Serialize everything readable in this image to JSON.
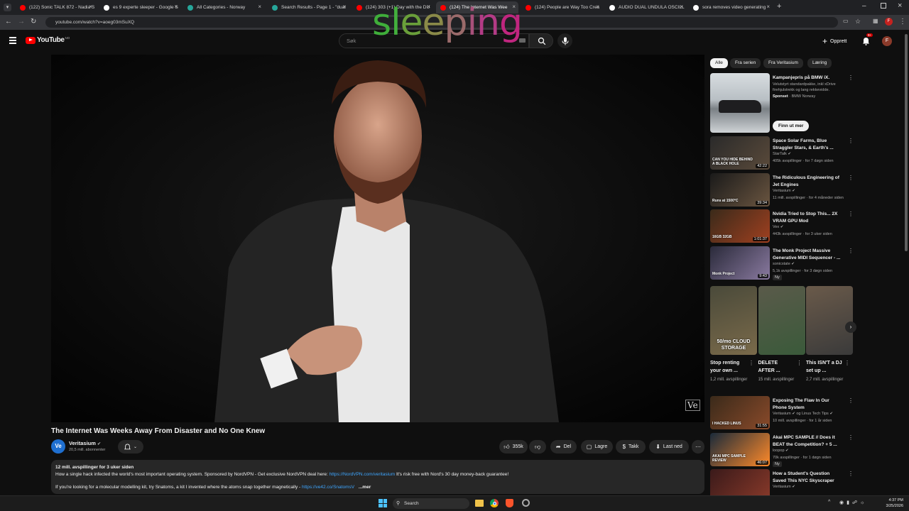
{
  "browser": {
    "tabs": [
      {
        "label": "(122) Sonic TALK 872 - Nadia S",
        "color": "#ff0000"
      },
      {
        "label": "es 9 experte sleeper - Google S",
        "color": "#ffffff"
      },
      {
        "label": "All Categories - Norway",
        "color": "#26a69a"
      },
      {
        "label": "Search Results - Page 1 - \"dual",
        "color": "#26a69a"
      },
      {
        "label": "(124) 303 (+1) Day with the DU",
        "color": "#ff0000"
      },
      {
        "label": "(124) The Internet Was Wee",
        "color": "#ff0000",
        "active": true
      },
      {
        "label": "(124) People are Way Too Crea",
        "color": "#ff0000"
      },
      {
        "label": "AUDIO DUAL UNDULA OSCILL",
        "color": "#ffffff"
      },
      {
        "label": "sora removes video generating",
        "color": "#ffffff"
      }
    ],
    "url": "youtube.com/watch?v=aoeg03mSuXQ"
  },
  "overlay_text": "sleeping",
  "youtube": {
    "logo_text": "YouTube",
    "region": "NO",
    "search_placeholder": "Søk",
    "create_label": "Opprett",
    "notif_count": "9+",
    "avatar_letter": "F"
  },
  "video": {
    "watermark": "Ve",
    "title": "The Internet Was Weeks Away From Disaster and No One Knew",
    "channel": "Veritasium",
    "channel_initials": "Ve",
    "subscribers": "20,5 mill. abonnenter",
    "likes": "355k",
    "share_label": "Del",
    "save_label": "Lagre",
    "thanks_label": "Takk",
    "download_label": "Last ned"
  },
  "description": {
    "stats": "12 mill. avspillinger  for 3 uker siden",
    "line1_a": "How a single hack infected the world's most important operating system. Sponsored by NordVPN - Get exclusive NordVPN deal here: ",
    "line1_link": "https://NordVPN.com/veritasium",
    "line1_b": " It's risk free with Nord's 30 day money-back guarantee!",
    "line2_a": "If you're looking for a molecular modelling kit, try Snatoms, a kit I invented where the atoms snap together magnetically - ",
    "line2_link": "https://ve42.co/SnatomsV",
    "more": "...mer"
  },
  "sidebar": {
    "chips": [
      "Alle",
      "Fra serien",
      "Fra Veritasium",
      "Læring"
    ],
    "ad": {
      "title": "Kampanjepris på BMW iX.",
      "body": "Velutstyrt standardpakke, inkl xDrive firehjulstrekk og lang rekkevidde.",
      "sponsor_label": "Sponset",
      "sponsor": "· BMW Norway",
      "cta": "Finn ut mer"
    },
    "videos": [
      {
        "title": "Space Solar Farms, Blue Straggler Stars, & Earth's ...",
        "channel": "StarTalk",
        "meta": "405k avspillinger · for 7 døgn siden",
        "duration": "42:22",
        "thumb_text": "CAN YOU HIDE BEHIND A BLACK HOLE",
        "c1": "#2a2a2a",
        "c2": "#5a4a3a"
      },
      {
        "title": "The Ridiculous Engineering of Jet Engines",
        "channel": "Veritasium",
        "meta": "11 mill. avspillinger · for 4 måneder siden",
        "duration": "39:34",
        "thumb_text": "Runs at 1500°C",
        "c1": "#1a1a1a",
        "c2": "#6a5540"
      },
      {
        "title": "Nvidia Tried to Stop This... 2X VRAM GPU Mod",
        "channel": "Vex",
        "meta": "443k avspillinger · for 3 uker siden",
        "duration": "1:01:37",
        "thumb_text": "16GB 32GB",
        "c1": "#3a2a1a",
        "c2": "#a04020"
      },
      {
        "title": "The Monk Project Massive Generative MIDI Sequencer - ...",
        "channel": "sonicstate",
        "meta": "5,1k avspillinger · for 3 døgn siden",
        "duration": "9:43",
        "thumb_text": "Monk Project",
        "badge": "Ny",
        "c1": "#2a2a3a",
        "c2": "#8a7aa0"
      }
    ],
    "shorts": [
      {
        "title": "Stop renting your own ...",
        "views": "1,2 mill. avspillinger",
        "caption": "50/mo CLOUD STORAGE",
        "c1": "#4a4a3a",
        "c2": "#7a6a4a"
      },
      {
        "title": "DELETE AFTER ...",
        "views": "15 mill. avspillinger",
        "caption": "",
        "c1": "#5a5a4a",
        "c2": "#3a5a3a"
      },
      {
        "title": "This ISN'T a DJ set up ...",
        "views": "2,7 mill. avspillinger",
        "caption": "",
        "c1": "#6a5a4a",
        "c2": "#3a3a3a"
      }
    ],
    "videos2": [
      {
        "title": "Exposing The Flaw In Our Phone System",
        "channel": "Veritasium",
        "channel_extra": "og Linus Tech Tips",
        "meta": "10 mill. avspillinger · for 1 år siden",
        "duration": "31:55",
        "thumb_text": "I HACKED LINUS",
        "c1": "#3a2a1a",
        "c2": "#8a4a2a"
      },
      {
        "title": "Akai MPC SAMPLE // Does it BEAT the Competition? + 5 ...",
        "channel": "loopop",
        "meta": "70k avspillinger · for 1 døgn siden",
        "duration": "46:07",
        "thumb_text": "AKAI MPC SAMPLE REVIEW",
        "badge": "Ny",
        "c1": "#1a2a3a",
        "c2": "#ff8a2a"
      },
      {
        "title": "How a Student's Question Saved This NYC Skyscraper",
        "channel": "Veritasium",
        "meta": "",
        "duration": "",
        "thumb_text": "",
        "c1": "#3a1a1a",
        "c2": "#8a3a2a"
      }
    ]
  },
  "taskbar": {
    "search_label": "Search",
    "time": "4:37 PM",
    "date": "3/25/2026"
  }
}
